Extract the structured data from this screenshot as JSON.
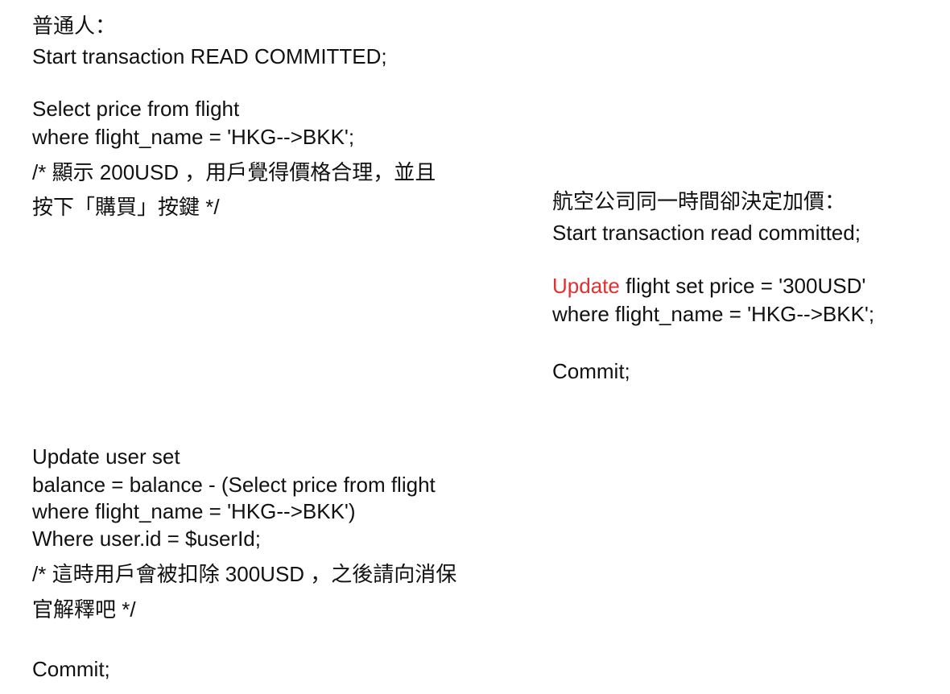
{
  "left": {
    "lines": [
      "普通人：",
      "Start transaction READ COMMITTED;",
      "Select price from flight",
      "where flight_name = 'HKG-->BKK';",
      "/* 顯示  200USD ，用戶覺得價格合理，並且",
      "按下「購買」按鍵 */",
      "Update user set",
      "balance = balance - (Select price from flight",
      "where flight_name = 'HKG-->BKK')",
      "Where user.id = $userId;",
      "/* 這時用戶會被扣除 300USD ，之後請向消保",
      "官解釋吧 */",
      "Commit;"
    ]
  },
  "right": {
    "title": "航空公司同一時間卻決定加價：",
    "start": "Start transaction read committed;",
    "update_keyword": "Update",
    "update_rest": " flight set price = '300USD'",
    "where": "where flight_name = 'HKG-->BKK';",
    "commit": "Commit;"
  },
  "colors": {
    "text": "#111111",
    "keyword": "#e03030",
    "background": "#ffffff"
  }
}
